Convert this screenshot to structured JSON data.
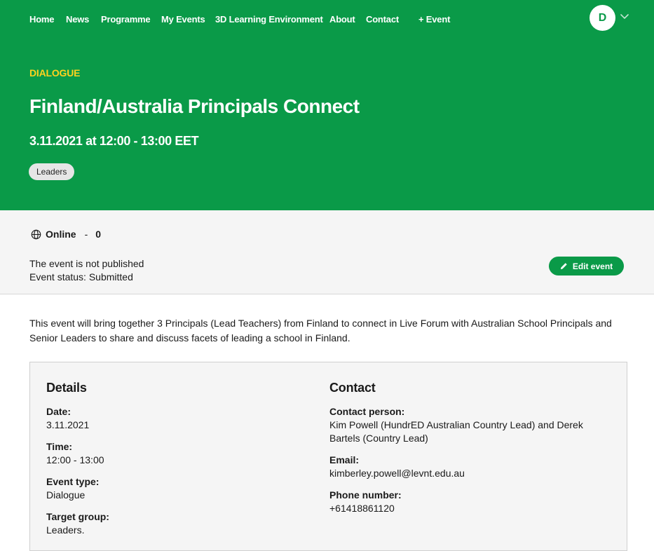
{
  "nav": {
    "items": [
      {
        "label": "Home"
      },
      {
        "label": "News"
      },
      {
        "label": "Programme"
      },
      {
        "label": "My Events"
      },
      {
        "label": "3D Learning Environment"
      },
      {
        "label": "About"
      },
      {
        "label": "Contact"
      },
      {
        "label": "+ Event"
      }
    ],
    "avatar_initial": "D"
  },
  "event": {
    "category": "DIALOGUE",
    "title": "Finland/Australia Principals Connect",
    "datetime": "3.11.2021 at 12:00 - 13:00 EET",
    "tag": "Leaders"
  },
  "info": {
    "location": "Online",
    "separator": "-",
    "count": "0",
    "status_line1": "The event is not published",
    "status_line2": "Event status: Submitted",
    "edit_label": "Edit event"
  },
  "description": "This event will bring together 3 Principals (Lead Teachers) from Finland to connect in  Live Forum with Australian School Principals and Senior Leaders to share and discuss facets of leading a school in Finland.",
  "details": {
    "heading": "Details",
    "fields": [
      {
        "label": "Date:",
        "value": "3.11.2021"
      },
      {
        "label": "Time:",
        "value": "12:00 - 13:00"
      },
      {
        "label": "Event type:",
        "value": "Dialogue"
      },
      {
        "label": "Target group:",
        "value": "Leaders."
      }
    ]
  },
  "contact": {
    "heading": "Contact",
    "fields": [
      {
        "label": "Contact person:",
        "value": "Kim Powell (HundrED Australian Country Lead) and Derek Bartels (Country Lead)"
      },
      {
        "label": "Email:",
        "value": "kimberley.powell@levnt.edu.au"
      },
      {
        "label": "Phone number:",
        "value": "+61418861120"
      }
    ]
  },
  "colors": {
    "brand_green": "#0a9a48",
    "eyebrow_yellow": "#ffd21f"
  }
}
